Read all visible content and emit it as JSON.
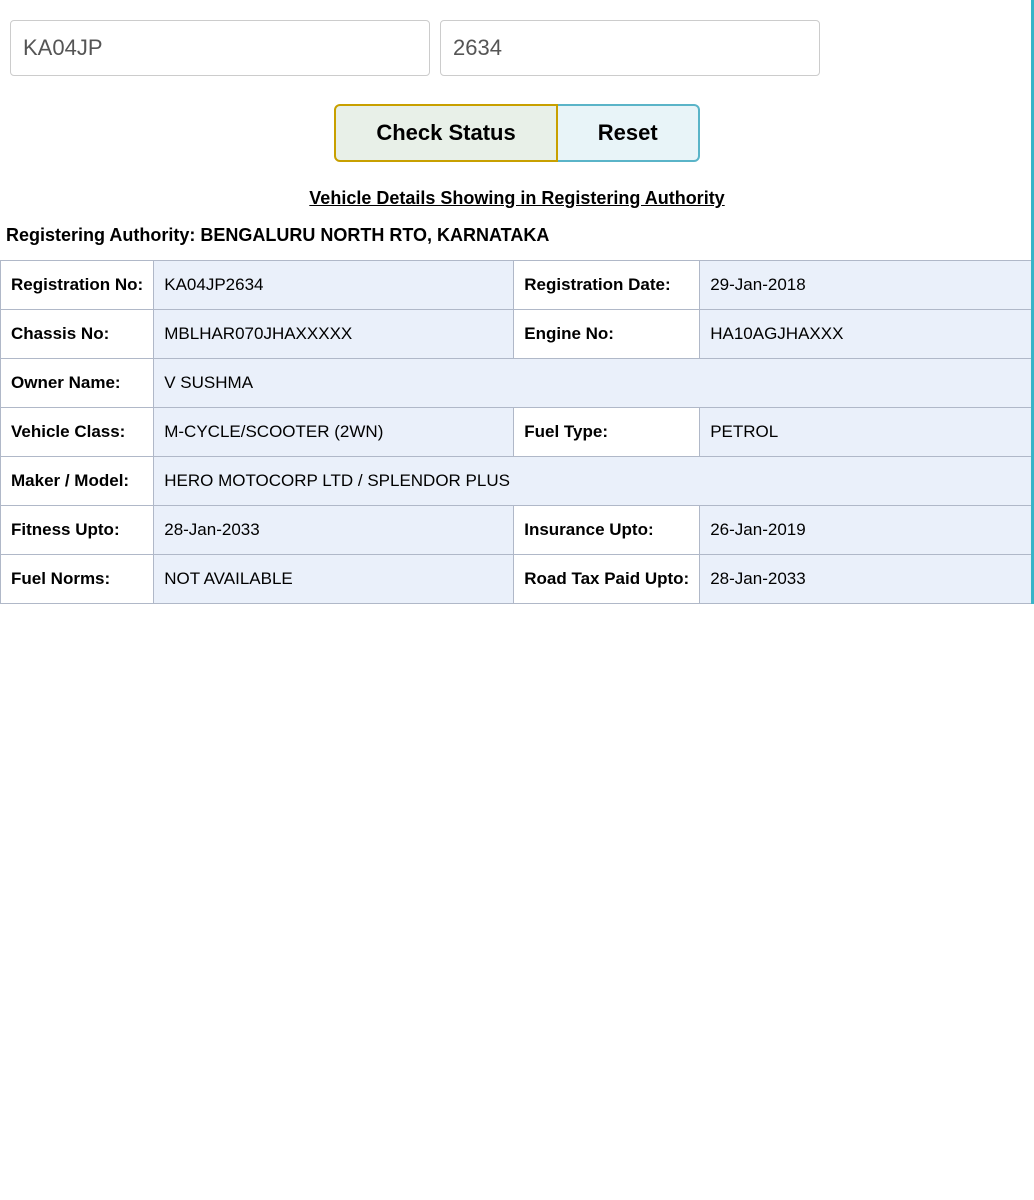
{
  "inputs": {
    "reg_placeholder": "KA04JP",
    "num_placeholder": "2634"
  },
  "buttons": {
    "check_status": "Check Status",
    "reset": "Reset"
  },
  "section": {
    "title": "Vehicle Details Showing in Registering Authority",
    "authority_label": "Registering Authority:",
    "authority_value": "BENGALURU NORTH RTO, KARNATAKA"
  },
  "table": {
    "rows": [
      {
        "label1": "Registration No:",
        "value1": "KA04JP2634",
        "label2": "Registration Date:",
        "value2": "29-Jan-2018"
      },
      {
        "label1": "Chassis No:",
        "value1": "MBLHAR070JHAXXXXX",
        "label2": "Engine No:",
        "value2": "HA10AGJHAXXX"
      },
      {
        "label1": "Owner Name:",
        "value1": "V SUSHMA",
        "label2": "",
        "value2": ""
      },
      {
        "label1": "Vehicle Class:",
        "value1": "M-CYCLE/SCOOTER (2WN)",
        "label2": "Fuel Type:",
        "value2": "PETROL"
      },
      {
        "label1": "Maker / Model:",
        "value1": "HERO MOTOCORP LTD / SPLENDOR PLUS",
        "label2": "",
        "value2": ""
      },
      {
        "label1": "Fitness Upto:",
        "value1": "28-Jan-2033",
        "label2": "Insurance Upto:",
        "value2": "26-Jan-2019"
      },
      {
        "label1": "Fuel Norms:",
        "value1": "NOT AVAILABLE",
        "label2": "Road Tax Paid Upto:",
        "value2": "28-Jan-2033"
      }
    ]
  }
}
